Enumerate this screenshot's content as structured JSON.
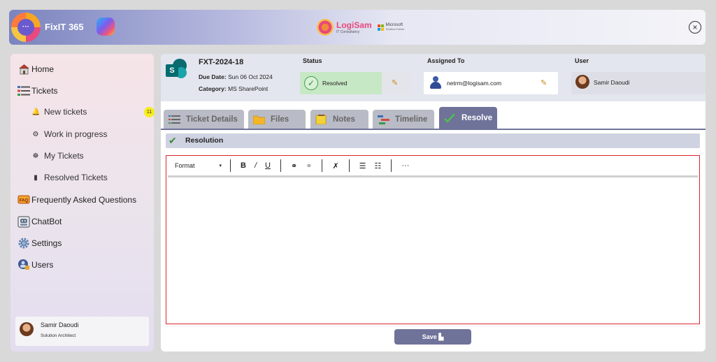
{
  "header": {
    "app_name": "FixIT 365",
    "partner_name": "LogiSam",
    "partner_tagline": "IT Consultancy",
    "ms_name": "Microsoft",
    "ms_sub": "Solutions Partner",
    "close_glyph": "×"
  },
  "sidebar": {
    "items": [
      {
        "label": "Home",
        "icon": "home-icon"
      },
      {
        "label": "Tickets",
        "icon": "tickets-icon"
      },
      {
        "label": "Frequently Asked Questions",
        "icon": "faq-icon"
      },
      {
        "label": "ChatBot",
        "icon": "chatbot-icon"
      },
      {
        "label": "Settings",
        "icon": "gear-icon"
      },
      {
        "label": "Users",
        "icon": "users-icon"
      }
    ],
    "sub_items": [
      {
        "label": "New tickets",
        "icon": "bell-icon"
      },
      {
        "label": "Work in progress",
        "icon": "progress-icon"
      },
      {
        "label": "My Tickets",
        "icon": "my-tickets-icon"
      },
      {
        "label": "Resolved Tickets",
        "icon": "resolved-icon"
      }
    ],
    "new_tickets_count": "11",
    "profile": {
      "name": "Samir Daoudi",
      "role": "Solution Architect"
    }
  },
  "ticket": {
    "id": "FXT-2024-18",
    "due_label": "Due Date:",
    "due_value": "Sun 06 Oct 2024",
    "category_label": "Category:",
    "category_value": "MS SharePoint",
    "status_label": "Status",
    "status_value": "Resolved",
    "assigned_label": "Assigned To",
    "assigned_value": "netrm@logisam.com",
    "user_label": "User",
    "user_value": "Samir Daoudi"
  },
  "tabs": [
    {
      "label": "Ticket Details",
      "icon": "list-icon"
    },
    {
      "label": "Files",
      "icon": "folder-icon"
    },
    {
      "label": "Notes",
      "icon": "notes-icon"
    },
    {
      "label": "Timeline",
      "icon": "timeline-icon"
    },
    {
      "label": "Resolve",
      "icon": "check-icon",
      "active": true
    }
  ],
  "resolution": {
    "title": "Resolution"
  },
  "editor": {
    "format_label": "Format",
    "bold": "B",
    "italic": "/",
    "underline": "U",
    "more": "···"
  },
  "save_label": "Save"
}
